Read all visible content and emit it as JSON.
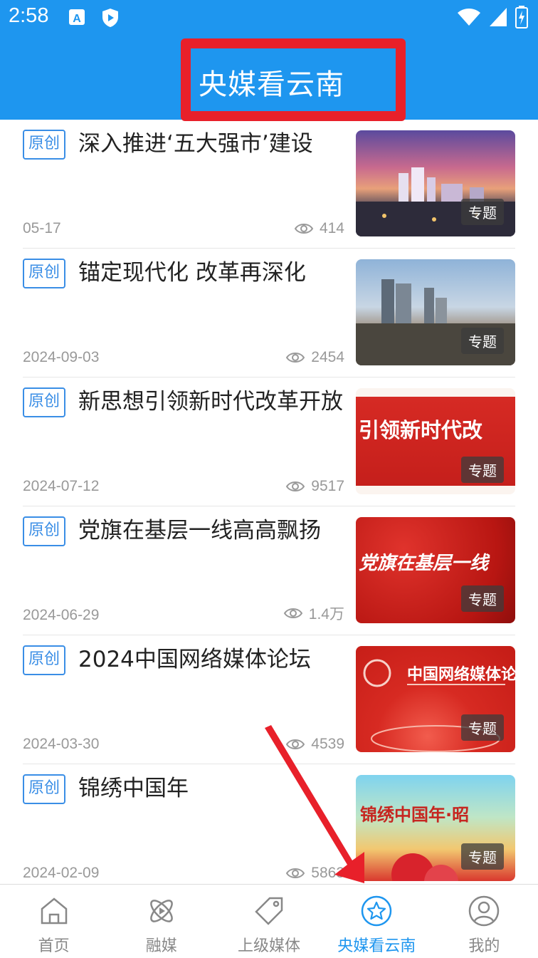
{
  "status_bar": {
    "time": "2:58"
  },
  "header": {
    "title": "央媒看云南"
  },
  "colors": {
    "brand": "#1e96ef",
    "tag": "#3a8ee6",
    "annotation": "#e8202a"
  },
  "news": [
    {
      "tag": "原创",
      "title": "深入推进‘五大强市’建设",
      "date": "05-17",
      "views": "414",
      "badge": "专题",
      "thumb_text": ""
    },
    {
      "tag": "原创",
      "title": "锚定现代化 改革再深化",
      "date": "2024-09-03",
      "views": "2454",
      "badge": "专题",
      "thumb_text": ""
    },
    {
      "tag": "原创",
      "title": "新思想引领新时代改革开放",
      "date": "2024-07-12",
      "views": "9517",
      "badge": "专题",
      "thumb_text": "引领新时代改"
    },
    {
      "tag": "原创",
      "title": "党旗在基层一线高高飘扬",
      "date": "2024-06-29",
      "views": "1.4万",
      "badge": "专题",
      "thumb_text": "党旗在基层一线"
    },
    {
      "tag": "原创",
      "title": "2024中国网络媒体论坛",
      "date": "2024-03-30",
      "views": "4539",
      "badge": "专题",
      "thumb_text": "中国网络媒体论"
    },
    {
      "tag": "原创",
      "title": "锦绣中国年",
      "date": "2024-02-09",
      "views": "5863",
      "badge": "专题",
      "thumb_text": "锦绣中国年·昭"
    }
  ],
  "nav": [
    {
      "label": "首页",
      "icon": "home-icon"
    },
    {
      "label": "融媒",
      "icon": "atom-icon"
    },
    {
      "label": "上级媒体",
      "icon": "tag-icon"
    },
    {
      "label": "央媒看云南",
      "icon": "star-icon"
    },
    {
      "label": "我的",
      "icon": "user-icon"
    }
  ]
}
